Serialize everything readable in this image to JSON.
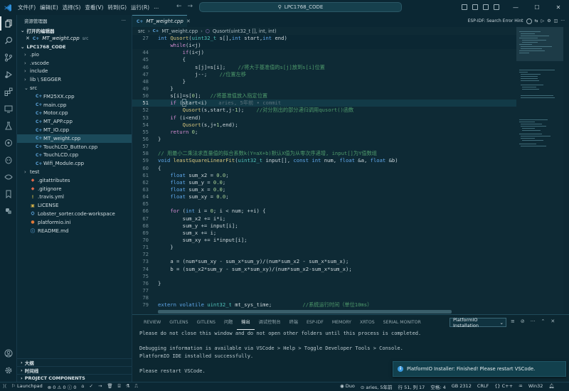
{
  "titlebar": {
    "menus": [
      "文件(F)",
      "编辑(E)",
      "选择(S)",
      "查看(V)",
      "转到(G)",
      "运行(R)",
      "..."
    ],
    "search_text": "LPC1768_CODE",
    "controls": {
      "minimize": "—",
      "maximize": "☐",
      "close": "✕"
    }
  },
  "sidebar": {
    "title": "资源管理器",
    "open_editors_label": "打开的编辑器",
    "open_editor": {
      "name": "MT_weight.cpp",
      "dir": "src"
    },
    "root_label": "LPC1768_CODE",
    "tree": [
      {
        "label": ".pio",
        "type": "folder",
        "depth": 1
      },
      {
        "label": ".vscode",
        "type": "folder",
        "depth": 1
      },
      {
        "label": "include",
        "type": "folder",
        "depth": 1
      },
      {
        "label": "lib \\ SEGGER",
        "type": "folder",
        "depth": 1
      },
      {
        "label": "src",
        "type": "folder-open",
        "depth": 1
      },
      {
        "label": "FM25XX.cpp",
        "type": "cpp",
        "depth": 2
      },
      {
        "label": "main.cpp",
        "type": "cpp",
        "depth": 2
      },
      {
        "label": "Motor.cpp",
        "type": "cpp",
        "depth": 2
      },
      {
        "label": "MT_APP.cpp",
        "type": "cpp",
        "depth": 2
      },
      {
        "label": "MT_IO.cpp",
        "type": "cpp",
        "depth": 2
      },
      {
        "label": "MT_weight.cpp",
        "type": "cpp",
        "depth": 2,
        "selected": true
      },
      {
        "label": "TouchLCD_Button.cpp",
        "type": "cpp",
        "depth": 2
      },
      {
        "label": "TouchLCD.cpp",
        "type": "cpp",
        "depth": 2
      },
      {
        "label": "Wifi_Module.cpp",
        "type": "cpp",
        "depth": 2
      },
      {
        "label": "test",
        "type": "folder",
        "depth": 1
      },
      {
        "label": ".gitattributes",
        "type": "git",
        "depth": 1
      },
      {
        "label": ".gitignore",
        "type": "git",
        "depth": 1
      },
      {
        "label": ".travis.yml",
        "type": "yml",
        "depth": 1
      },
      {
        "label": "LICENSE",
        "type": "license",
        "depth": 1
      },
      {
        "label": "Lobster_sorter.code-workspace",
        "type": "workspace",
        "depth": 1
      },
      {
        "label": "platformio.ini",
        "type": "pio",
        "depth": 1
      },
      {
        "label": "README.md",
        "type": "md",
        "depth": 1
      }
    ],
    "outline_label": "大纲",
    "timeline_label": "时间线",
    "project_components_label": "PROJECT COMPONENTS"
  },
  "editor": {
    "tab_label": "MT_weight.cpp",
    "breadcrumb": [
      "src",
      "MT_weight.cpp",
      "Qusort(uint32_t [], int, int)"
    ],
    "hint": "ESP-IDF: Search Error Hint",
    "sticky_line": {
      "num": "27",
      "text": "int Qusort(uint32_t s[],int start,int end)"
    },
    "sticky_line2": {
      "num": "",
      "text": "    while(i<j)"
    },
    "blame": "aries, 5年前 • commit",
    "comments": {
      "swap": "//将大于基准值的s[j]放到s[i]位置",
      "move": "//位置左移",
      "store": "//将基准值放入指定位置",
      "recurse": "//对分割出的部分递归调用qusort()函数",
      "lsq": "// 用最小二乘法求直量值的拟合系数k(Y=aX+b)默认X值为从零次序递增, input[]为Y值数组",
      "systime": "//系统运行时间（单位10ms）"
    }
  },
  "panel": {
    "tabs": [
      "REVIEW",
      "GITLENS",
      "GITLENS",
      "问题",
      "输出",
      "调试控制台",
      "终端",
      "ESP-IDF",
      "MEMORY",
      "XRTOS",
      "SERIAL MONITOR"
    ],
    "active_tab": "输出",
    "channel": "PlatformIO Installation",
    "output_lines": [
      "Please do not close this window and do not open other folders until this process is completed.",
      "",
      "Debugging information is available via VSCode > Help > Toggle Developer Tools > Console.",
      "PlatformIO IDE installed successfully.",
      "",
      "Please restart VSCode."
    ]
  },
  "toast": {
    "message": "PlatformIO Installer: Finished! Please restart VSCode."
  },
  "statusbar": {
    "launchpad": "Launchpad",
    "errors": "0",
    "warnings": "0",
    "problems": "0",
    "duo": "Duo",
    "blame": "aries, 5年前",
    "position": "行 51, 列 17",
    "spaces": "空格: 4",
    "encoding": "GB 2312",
    "eol": "CRLF",
    "language": "{} C++",
    "platform": "Win32"
  }
}
